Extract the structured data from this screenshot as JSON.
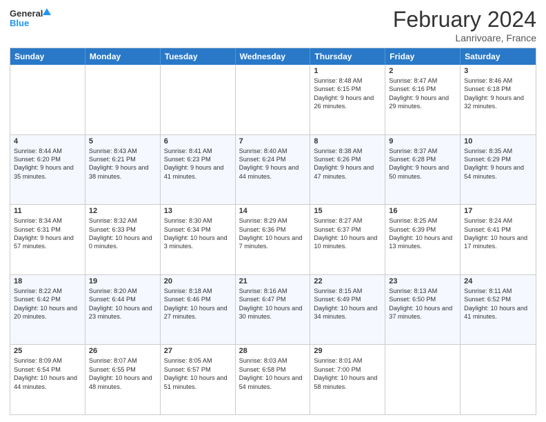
{
  "logo": {
    "line1": "General",
    "line2": "Blue"
  },
  "title": "February 2024",
  "subtitle": "Lanrivoare, France",
  "headers": [
    "Sunday",
    "Monday",
    "Tuesday",
    "Wednesday",
    "Thursday",
    "Friday",
    "Saturday"
  ],
  "rows": [
    [
      {
        "day": "",
        "text": ""
      },
      {
        "day": "",
        "text": ""
      },
      {
        "day": "",
        "text": ""
      },
      {
        "day": "",
        "text": ""
      },
      {
        "day": "1",
        "text": "Sunrise: 8:48 AM\nSunset: 6:15 PM\nDaylight: 9 hours and 26 minutes."
      },
      {
        "day": "2",
        "text": "Sunrise: 8:47 AM\nSunset: 6:16 PM\nDaylight: 9 hours and 29 minutes."
      },
      {
        "day": "3",
        "text": "Sunrise: 8:46 AM\nSunset: 6:18 PM\nDaylight: 9 hours and 32 minutes."
      }
    ],
    [
      {
        "day": "4",
        "text": "Sunrise: 8:44 AM\nSunset: 6:20 PM\nDaylight: 9 hours and 35 minutes."
      },
      {
        "day": "5",
        "text": "Sunrise: 8:43 AM\nSunset: 6:21 PM\nDaylight: 9 hours and 38 minutes."
      },
      {
        "day": "6",
        "text": "Sunrise: 8:41 AM\nSunset: 6:23 PM\nDaylight: 9 hours and 41 minutes."
      },
      {
        "day": "7",
        "text": "Sunrise: 8:40 AM\nSunset: 6:24 PM\nDaylight: 9 hours and 44 minutes."
      },
      {
        "day": "8",
        "text": "Sunrise: 8:38 AM\nSunset: 6:26 PM\nDaylight: 9 hours and 47 minutes."
      },
      {
        "day": "9",
        "text": "Sunrise: 8:37 AM\nSunset: 6:28 PM\nDaylight: 9 hours and 50 minutes."
      },
      {
        "day": "10",
        "text": "Sunrise: 8:35 AM\nSunset: 6:29 PM\nDaylight: 9 hours and 54 minutes."
      }
    ],
    [
      {
        "day": "11",
        "text": "Sunrise: 8:34 AM\nSunset: 6:31 PM\nDaylight: 9 hours and 57 minutes."
      },
      {
        "day": "12",
        "text": "Sunrise: 8:32 AM\nSunset: 6:33 PM\nDaylight: 10 hours and 0 minutes."
      },
      {
        "day": "13",
        "text": "Sunrise: 8:30 AM\nSunset: 6:34 PM\nDaylight: 10 hours and 3 minutes."
      },
      {
        "day": "14",
        "text": "Sunrise: 8:29 AM\nSunset: 6:36 PM\nDaylight: 10 hours and 7 minutes."
      },
      {
        "day": "15",
        "text": "Sunrise: 8:27 AM\nSunset: 6:37 PM\nDaylight: 10 hours and 10 minutes."
      },
      {
        "day": "16",
        "text": "Sunrise: 8:25 AM\nSunset: 6:39 PM\nDaylight: 10 hours and 13 minutes."
      },
      {
        "day": "17",
        "text": "Sunrise: 8:24 AM\nSunset: 6:41 PM\nDaylight: 10 hours and 17 minutes."
      }
    ],
    [
      {
        "day": "18",
        "text": "Sunrise: 8:22 AM\nSunset: 6:42 PM\nDaylight: 10 hours and 20 minutes."
      },
      {
        "day": "19",
        "text": "Sunrise: 8:20 AM\nSunset: 6:44 PM\nDaylight: 10 hours and 23 minutes."
      },
      {
        "day": "20",
        "text": "Sunrise: 8:18 AM\nSunset: 6:46 PM\nDaylight: 10 hours and 27 minutes."
      },
      {
        "day": "21",
        "text": "Sunrise: 8:16 AM\nSunset: 6:47 PM\nDaylight: 10 hours and 30 minutes."
      },
      {
        "day": "22",
        "text": "Sunrise: 8:15 AM\nSunset: 6:49 PM\nDaylight: 10 hours and 34 minutes."
      },
      {
        "day": "23",
        "text": "Sunrise: 8:13 AM\nSunset: 6:50 PM\nDaylight: 10 hours and 37 minutes."
      },
      {
        "day": "24",
        "text": "Sunrise: 8:11 AM\nSunset: 6:52 PM\nDaylight: 10 hours and 41 minutes."
      }
    ],
    [
      {
        "day": "25",
        "text": "Sunrise: 8:09 AM\nSunset: 6:54 PM\nDaylight: 10 hours and 44 minutes."
      },
      {
        "day": "26",
        "text": "Sunrise: 8:07 AM\nSunset: 6:55 PM\nDaylight: 10 hours and 48 minutes."
      },
      {
        "day": "27",
        "text": "Sunrise: 8:05 AM\nSunset: 6:57 PM\nDaylight: 10 hours and 51 minutes."
      },
      {
        "day": "28",
        "text": "Sunrise: 8:03 AM\nSunset: 6:58 PM\nDaylight: 10 hours and 54 minutes."
      },
      {
        "day": "29",
        "text": "Sunrise: 8:01 AM\nSunset: 7:00 PM\nDaylight: 10 hours and 58 minutes."
      },
      {
        "day": "",
        "text": ""
      },
      {
        "day": "",
        "text": ""
      }
    ]
  ]
}
